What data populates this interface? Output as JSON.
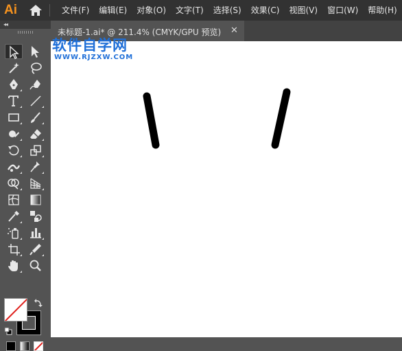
{
  "app": {
    "logo_text": "Ai"
  },
  "menu": {
    "items": [
      {
        "label": "文件(F)"
      },
      {
        "label": "编辑(E)"
      },
      {
        "label": "对象(O)"
      },
      {
        "label": "文字(T)"
      },
      {
        "label": "选择(S)"
      },
      {
        "label": "效果(C)"
      },
      {
        "label": "视图(V)"
      },
      {
        "label": "窗口(W)"
      },
      {
        "label": "帮助(H)"
      }
    ]
  },
  "document": {
    "tab_title": "未标题-1.ai* @ 211.4% (CMYK/GPU 预览)",
    "close_glyph": "✕"
  },
  "tools_panel": {
    "collapse_glyph": "◂◂",
    "tools": [
      "selection-tool-icon",
      "direct-selection-tool-icon",
      "magic-wand-tool-icon",
      "lasso-tool-icon",
      "pen-tool-icon",
      "curvature-tool-icon",
      "type-tool-icon",
      "line-segment-tool-icon",
      "rectangle-tool-icon",
      "paintbrush-tool-icon",
      "shaper-tool-icon",
      "eraser-tool-icon",
      "rotate-tool-icon",
      "scale-tool-icon",
      "width-tool-icon",
      "puppet-warp-tool-icon",
      "shape-builder-tool-icon",
      "perspective-grid-tool-icon",
      "mesh-tool-icon",
      "gradient-tool-icon",
      "eyedropper-tool-icon",
      "blend-tool-icon",
      "symbol-sprayer-tool-icon",
      "column-graph-tool-icon",
      "artboard-tool-icon",
      "slice-tool-icon",
      "hand-tool-icon",
      "zoom-tool-icon"
    ],
    "active_tool": "selection-tool-icon",
    "fill": "none",
    "stroke": "#000000"
  },
  "colors": {
    "menubar_bg": "#323232",
    "panel_bg": "#535353",
    "canvas_bg": "#ffffff",
    "accent_logo": "#f7931e",
    "watermark": "#1f6fd8",
    "none_slash": "#e0201c"
  },
  "watermark": {
    "title": "软件自学网",
    "url": "WWW.RJZXW.COM"
  }
}
